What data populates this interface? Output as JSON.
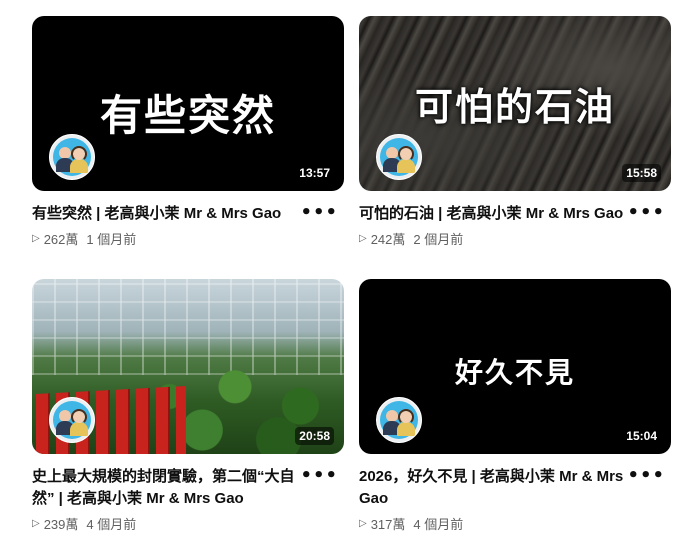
{
  "videos": [
    {
      "thumb_text": "有些突然",
      "duration": "13:57",
      "title": "有些突然 | 老高與小茉 Mr & Mrs Gao",
      "views": "262萬",
      "age": "1 個月前",
      "menu_icon": "more-vert-icon"
    },
    {
      "thumb_text": "可怕的石油",
      "duration": "15:58",
      "title": "可怕的石油 | 老高與小茉 Mr & Mrs Gao",
      "views": "242萬",
      "age": "2 個月前",
      "menu_icon": "more-vert-icon"
    },
    {
      "thumb_text": "",
      "duration": "20:58",
      "title": "史上最大規模的封閉實驗，第二個“大自然” | 老高與小茉 Mr & Mrs Gao",
      "views": "239萬",
      "age": "4 個月前",
      "menu_icon": "more-vert-icon"
    },
    {
      "thumb_text": "好久不見",
      "duration": "15:04",
      "title": "2026，好久不見 | 老高與小茉 Mr & Mrs Gao",
      "views": "317萬",
      "age": "4 個月前",
      "menu_icon": "more-vert-icon"
    }
  ],
  "icons": {
    "view": "play-triangle-icon",
    "menu": "more-vert-icon"
  },
  "colors": {
    "background": "#ffffff",
    "text": "#0f0f0f",
    "secondary": "#606060",
    "thumb_black": "#000000"
  }
}
